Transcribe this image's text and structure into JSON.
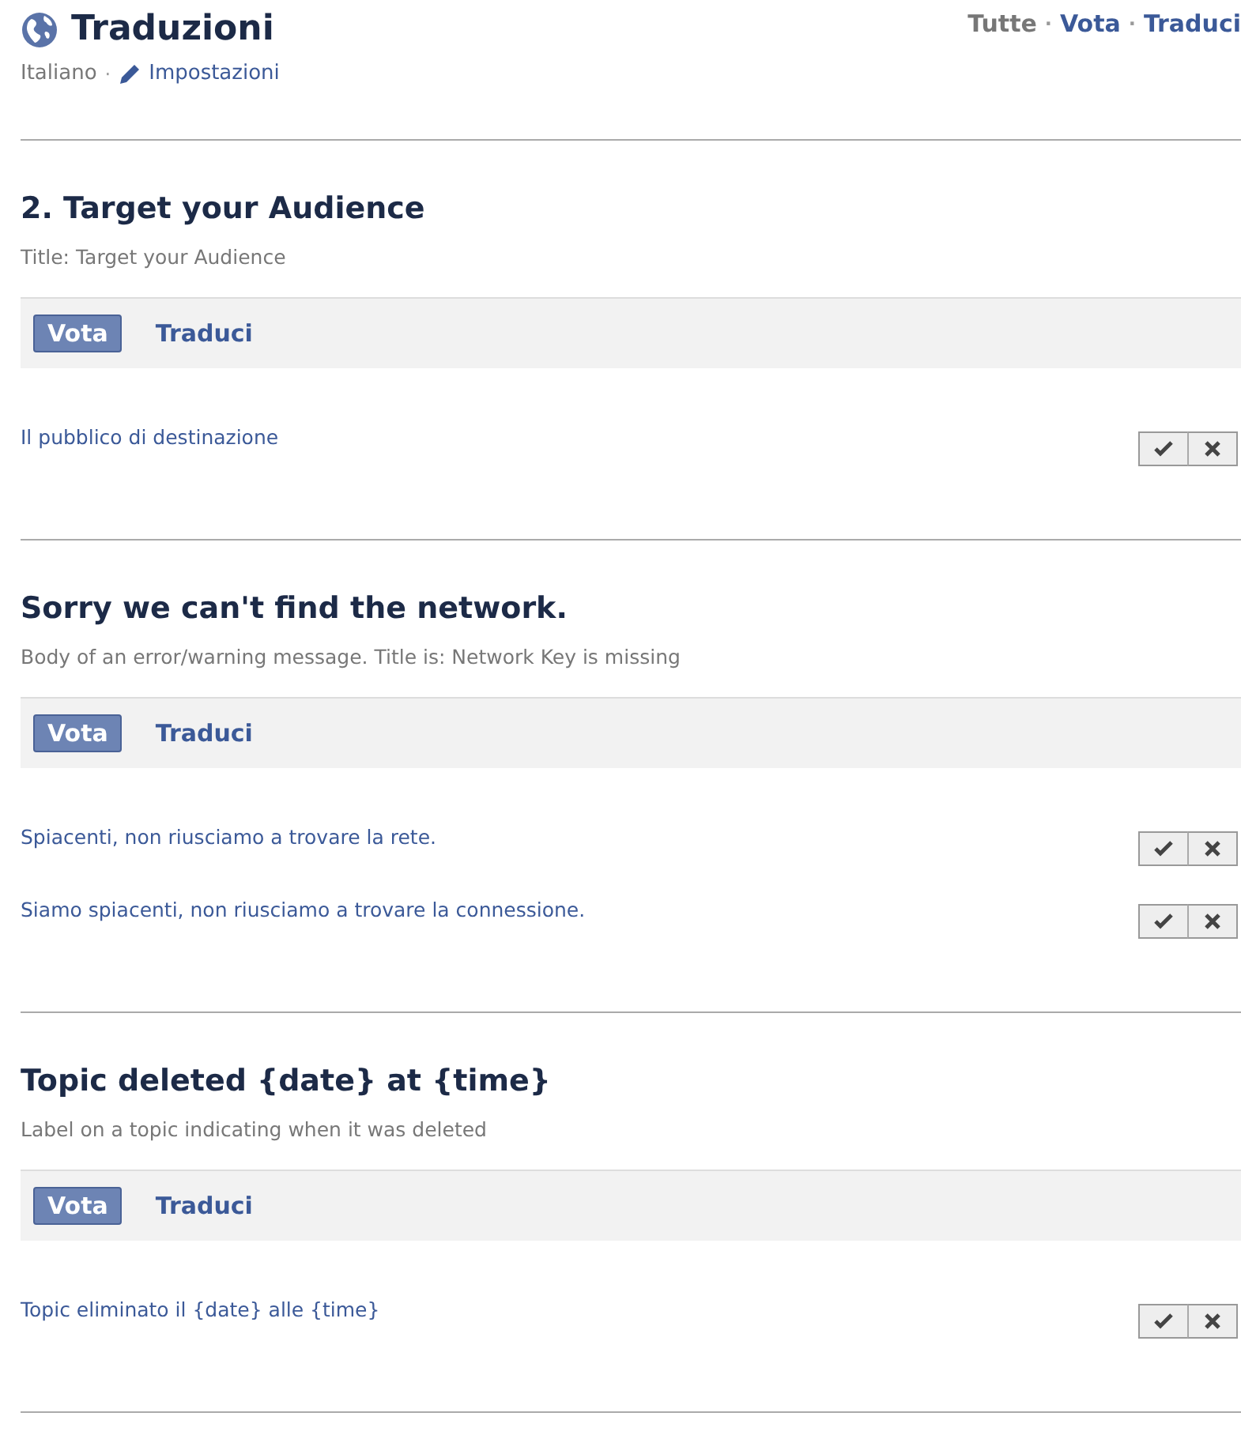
{
  "header": {
    "title": "Traduzioni",
    "language": "Italiano",
    "settings": "Impostazioni",
    "separator": "·"
  },
  "nav_separator": "·",
  "nav": [
    {
      "label": "Tutte",
      "selected": true
    },
    {
      "label": "Vota",
      "selected": false
    },
    {
      "label": "Traduci",
      "selected": false
    }
  ],
  "sections": [
    {
      "title": "2. Target your Audience",
      "description": "Title: Target your Audience",
      "tabs": [
        {
          "label": "Vota",
          "selected": true
        },
        {
          "label": "Traduci",
          "selected": false
        }
      ],
      "suggestions": [
        "Il pubblico di destinazione"
      ]
    },
    {
      "title": "Sorry we can't find the network.",
      "description": "Body of an error/warning message. Title is: Network Key is missing",
      "tabs": [
        {
          "label": "Vota",
          "selected": true
        },
        {
          "label": "Traduci",
          "selected": false
        }
      ],
      "suggestions": [
        "Spiacenti, non riusciamo a trovare la rete.",
        "Siamo spiacenti, non riusciamo a trovare la connessione."
      ]
    },
    {
      "title": "Topic deleted {date} at {time}",
      "description": "Label on a topic indicating when it was deleted",
      "tabs": [
        {
          "label": "Vota",
          "selected": true
        },
        {
          "label": "Traduci",
          "selected": false
        }
      ],
      "suggestions": [
        "Topic eliminato il {date} alle {time}"
      ]
    }
  ]
}
